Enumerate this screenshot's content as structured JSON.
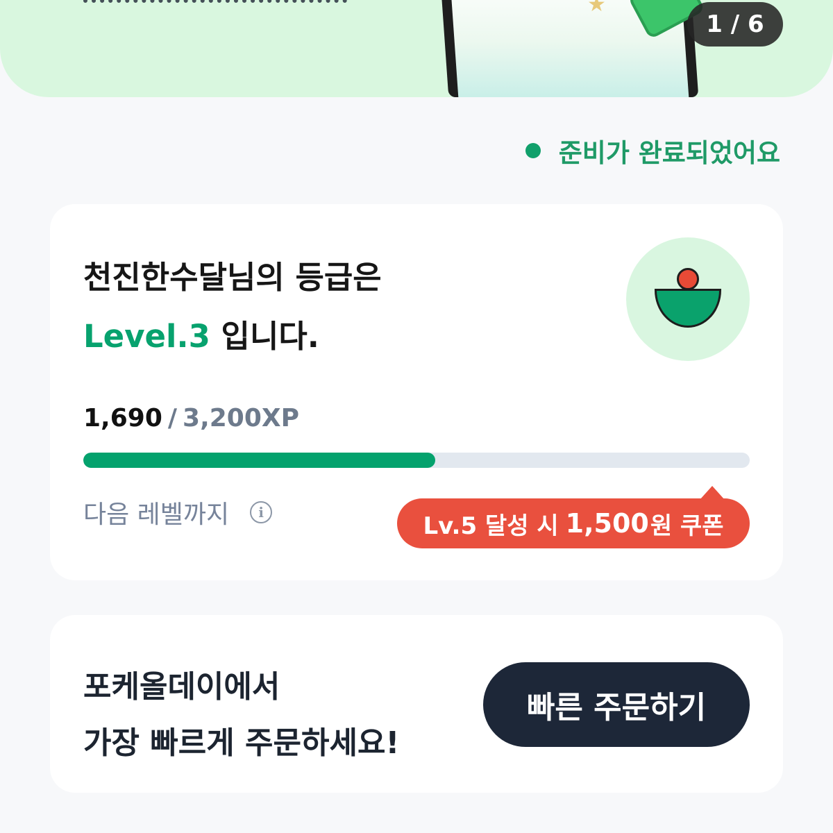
{
  "banner": {
    "page_indicator": "1 / 6"
  },
  "status": {
    "text": "준비가 완료되었어요"
  },
  "grade_card": {
    "title_line1": "천진한수달님의 등급은",
    "level_label": "Level.3",
    "title_line2_suffix": " 입니다.",
    "xp_current": "1,690",
    "xp_separator": "/",
    "xp_max": "3,200XP",
    "progress_fraction": 0.528,
    "next_level_label": "다음 레벨까지",
    "coupon_prefix": "Lv.5 달성 시",
    "coupon_amount": "1,500",
    "coupon_suffix": "원 쿠폰"
  },
  "order_card": {
    "line1": "포케올데이에서",
    "line2": "가장 빠르게 주문하세요!",
    "button_label": "빠른 주문하기"
  },
  "colors": {
    "brand_green": "#07a26e",
    "banner_bg": "#d9f7df",
    "coupon_red": "#e9503e",
    "button_navy": "#1d2738"
  }
}
